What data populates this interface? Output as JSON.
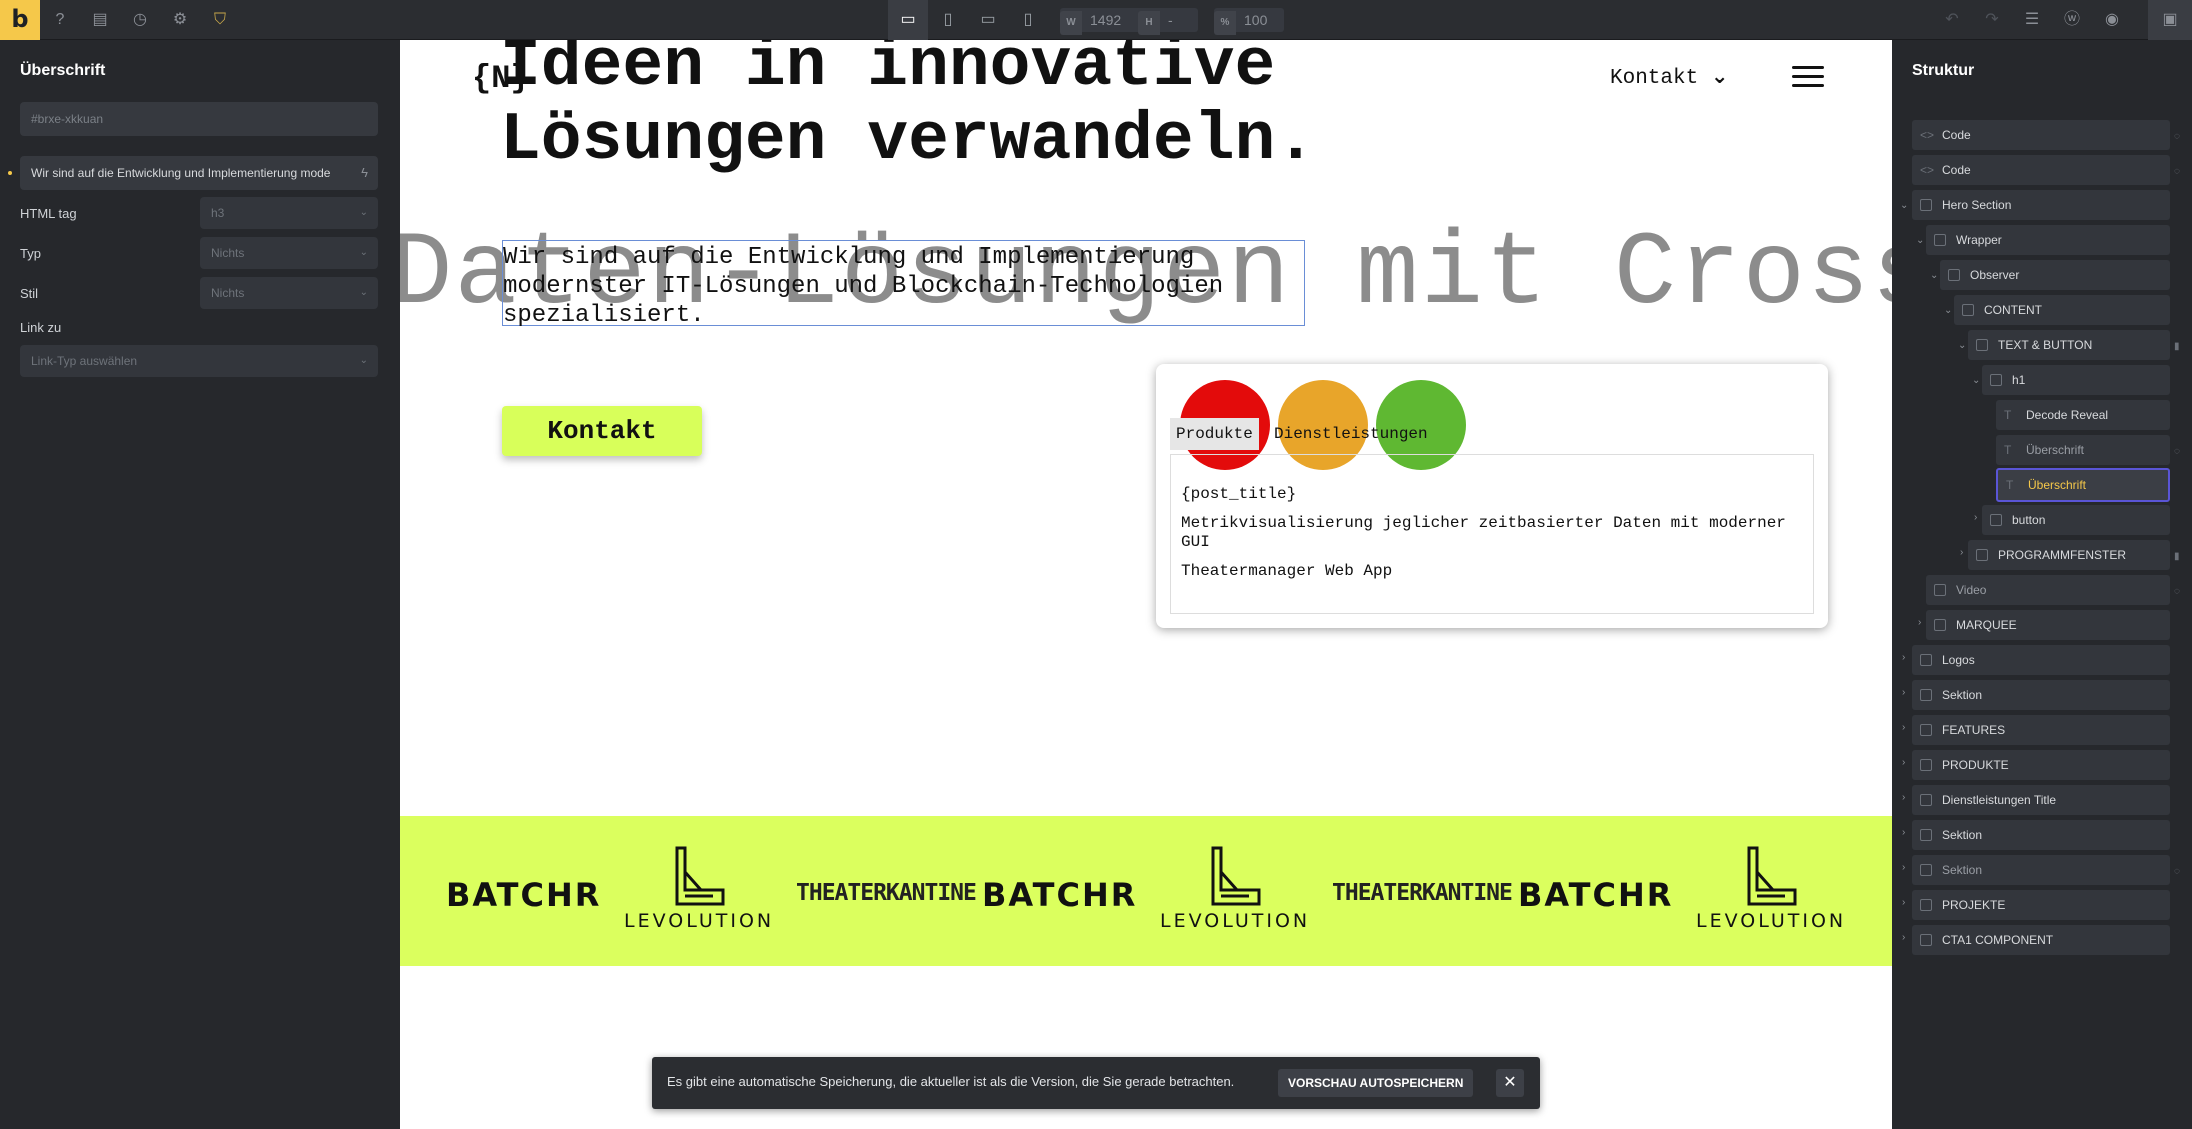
{
  "toolbar": {
    "logo_letter": "b",
    "width_label": "W",
    "width_value": "1492",
    "height_label": "H",
    "height_value": "-",
    "zoom_label": "%",
    "zoom_value": "100"
  },
  "left_panel": {
    "title": "Überschrift",
    "css_id_placeholder": "#brxe-xkkuan",
    "text_value": "Wir sind auf die Entwicklung und Implementierung mode",
    "html_tag_label": "HTML tag",
    "html_tag_value": "h3",
    "type_label": "Typ",
    "type_value": "Nichts",
    "style_label": "Stil",
    "style_value": "Nichts",
    "link_label": "Link zu",
    "link_placeholder": "Link-Typ auswählen"
  },
  "canvas": {
    "logo": "{N}",
    "nav_link": "Kontakt",
    "h1_line1": "Ideen in innovative",
    "h1_line2": "Lösungen verwandeln.",
    "bg_word": "Daten-Lösungen mit Cross-Pl",
    "h3_text": "Wir sind auf die Entwicklung und Implementierung modernster IT-Lösungen und Blockchain-Technologien spezialisiert.",
    "cta_label": "Kontakt",
    "window": {
      "tab1": "Produkte",
      "tab2": "Dienstleistungen",
      "line1": "{post_title}",
      "line2": "Metrikvisualisierung jeglicher zeitbasierter Daten mit moderner GUI",
      "line3": "Theatermanager Web App"
    },
    "marquee": {
      "batchr": "BATCHR",
      "levolution": "LEVOLUTION",
      "theaterkantine": "THEATERKANTINE"
    }
  },
  "right_panel": {
    "title": "Struktur",
    "items": [
      {
        "label": "Code"
      },
      {
        "label": "Code"
      },
      {
        "label": "Hero Section"
      },
      {
        "label": "Wrapper"
      },
      {
        "label": "Observer"
      },
      {
        "label": "CONTENT"
      },
      {
        "label": "TEXT & BUTTON"
      },
      {
        "label": "h1"
      },
      {
        "label": "Decode Reveal"
      },
      {
        "label": "Überschrift"
      },
      {
        "label": "Überschrift"
      },
      {
        "label": "button"
      },
      {
        "label": "PROGRAMMFENSTER"
      },
      {
        "label": "Video"
      },
      {
        "label": "MARQUEE"
      },
      {
        "label": "Logos"
      },
      {
        "label": "Sektion"
      },
      {
        "label": "FEATURES"
      },
      {
        "label": "PRODUKTE"
      },
      {
        "label": "Dienstleistungen Title"
      },
      {
        "label": "Sektion"
      },
      {
        "label": "Sektion"
      },
      {
        "label": "PROJEKTE"
      },
      {
        "label": "CTA1 COMPONENT"
      }
    ]
  },
  "toast": {
    "message": "Es gibt eine automatische Speicherung, die aktueller ist als die Version, die Sie gerade betrachten.",
    "button": "VORSCHAU AUTOSPEICHERN",
    "close": "✕"
  },
  "colors": {
    "accent": "#f5c84a",
    "selection": "#5a55d6",
    "cta_lime": "#d8ff5a",
    "dot_red": "#e30b0b",
    "dot_orange": "#e8a52a",
    "dot_green": "#5fb832"
  }
}
